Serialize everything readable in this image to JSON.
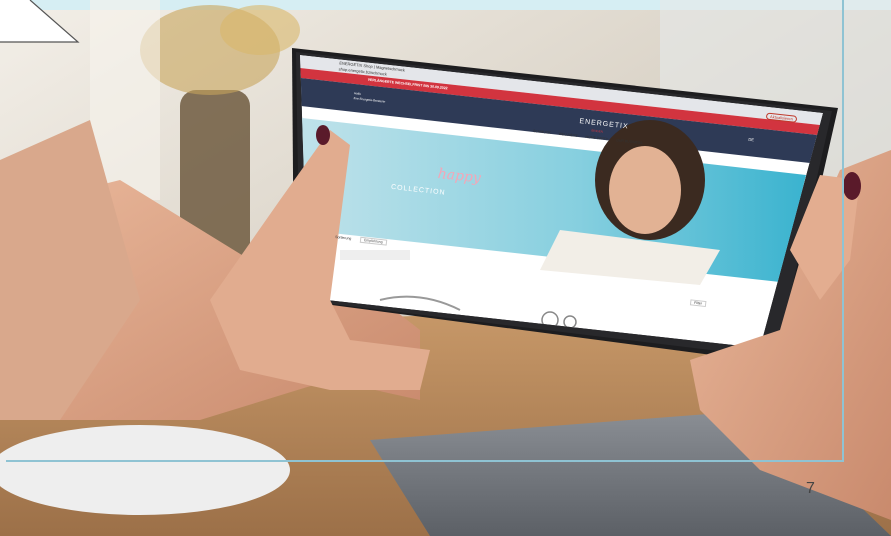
{
  "browser": {
    "tab_title": "ENERGETIX Shop | Magnetschmuck",
    "url": "shop.energetix.bz/schmuck",
    "update_button": "Aktualisieren"
  },
  "site": {
    "banner_text": "VERLÄNGERTE WECHSELFRIST BIS 30.09.2022",
    "brand": "ENERGETIX",
    "brand_sub": "BINGEN",
    "greeting": "Hallo",
    "advisor": "Ihre Energetix-Beraterin",
    "language": "DE",
    "nav": [
      "SCHMUCK",
      "WELLNESS",
      "HOME PARTY",
      "OUR BUSINESS"
    ],
    "hero_script": "happy",
    "hero_title": "COLLECTION",
    "sort_label": "Sortierung",
    "sort_value": "Empfehlung",
    "filter_label": "Filter"
  },
  "page": {
    "number": "7"
  },
  "colors": {
    "accent_frame": "#8fc3d3",
    "header_navy": "#2e3a56",
    "banner_red": "#d2343f",
    "hero_teal": "#4dbad2"
  }
}
